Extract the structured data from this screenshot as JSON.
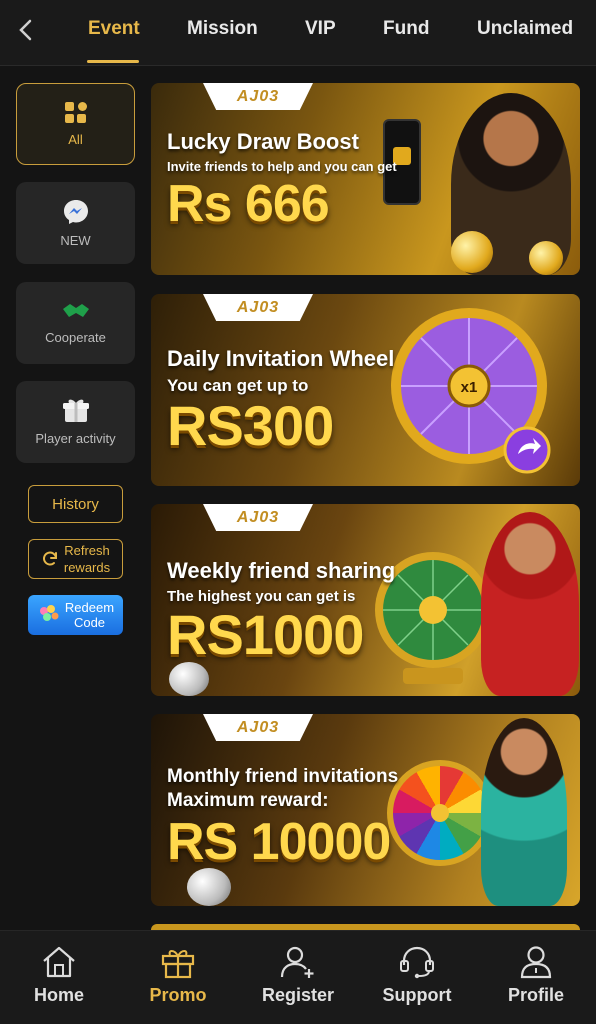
{
  "tabs": [
    {
      "label": "Event",
      "active": true
    },
    {
      "label": "Mission"
    },
    {
      "label": "VIP"
    },
    {
      "label": "Fund"
    },
    {
      "label": "Unclaimed"
    }
  ],
  "sidebar": {
    "items": [
      {
        "label": "All",
        "icon": "grid-icon",
        "active": true
      },
      {
        "label": "NEW",
        "icon": "messenger-icon"
      },
      {
        "label": "Cooperate",
        "icon": "handshake-icon"
      },
      {
        "label": "Player activity",
        "icon": "gift-icon"
      }
    ],
    "history_label": "History",
    "refresh_label_line1": "Refresh",
    "refresh_label_line2": "rewards",
    "redeem_label_line1": "Redeem",
    "redeem_label_line2": "Code"
  },
  "banners": [
    {
      "logo": "AJ03",
      "title": "Lucky Draw Boost",
      "subtitle": "Invite friends to help and you can get",
      "amount": "Rs 666"
    },
    {
      "logo": "AJ03",
      "title": "Daily Invitation Wheel",
      "subtitle": "You can get up to",
      "amount": "RS300",
      "wheel_center": "x1"
    },
    {
      "logo": "AJ03",
      "title": "Weekly friend sharing",
      "subtitle": "The highest you can get is",
      "amount": "RS1000"
    },
    {
      "logo": "AJ03",
      "title": "Monthly friend invitations",
      "subtitle": "Maximum reward:",
      "amount": "RS 10000"
    }
  ],
  "bottom_nav": [
    {
      "label": "Home",
      "icon": "home-icon"
    },
    {
      "label": "Promo",
      "icon": "gift-icon",
      "active": true
    },
    {
      "label": "Register",
      "icon": "add-user-icon"
    },
    {
      "label": "Support",
      "icon": "headset-icon"
    },
    {
      "label": "Profile",
      "icon": "profile-icon"
    }
  ],
  "colors": {
    "accent": "#e7b84a",
    "background": "#141414",
    "card": "#262626"
  }
}
